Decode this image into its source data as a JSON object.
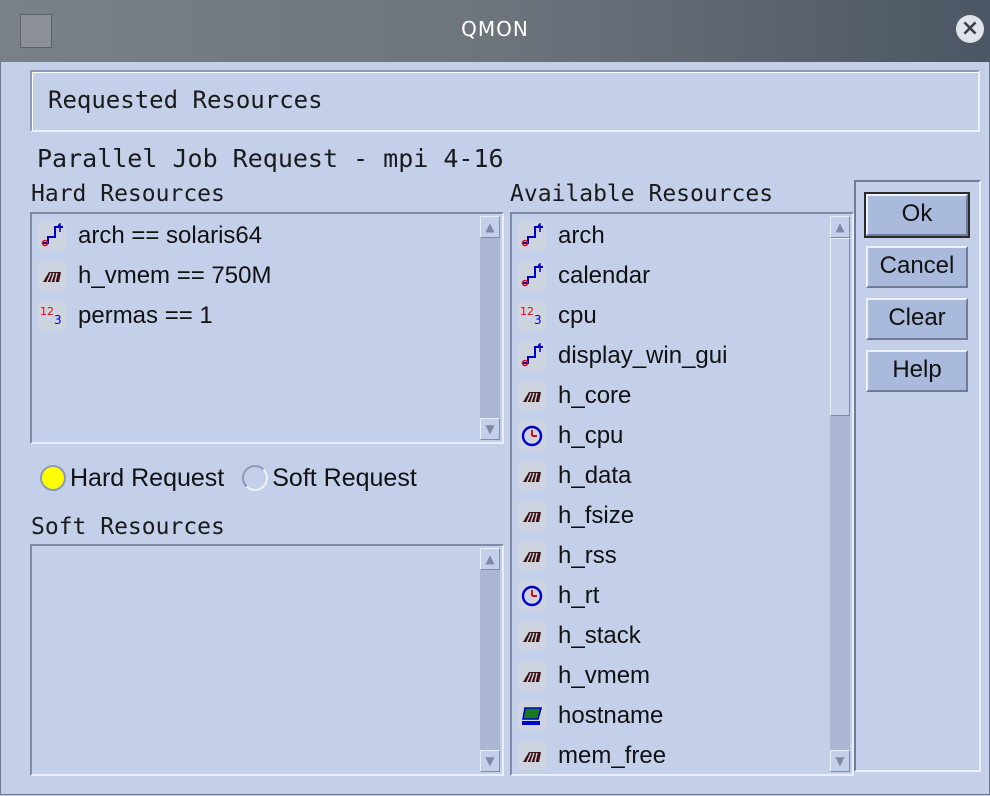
{
  "window": {
    "title": "QMON"
  },
  "header": {
    "requested_resources": "Requested Resources"
  },
  "labels": {
    "parallel_job": "Parallel Job Request - mpi 4-16",
    "hard_resources": "Hard Resources",
    "available_resources": "Available Resources",
    "soft_resources": "Soft Resources"
  },
  "hard_resources": [
    {
      "icon": "string-icon",
      "text": "arch == solaris64"
    },
    {
      "icon": "memory-icon",
      "text": "h_vmem == 750M"
    },
    {
      "icon": "integer-icon",
      "text": "permas == 1"
    }
  ],
  "soft_resources": [],
  "request_type": {
    "hard_label": "Hard Request",
    "soft_label": "Soft Request",
    "selected": "hard"
  },
  "available_resources": [
    {
      "icon": "string-icon",
      "text": "arch"
    },
    {
      "icon": "string-icon",
      "text": "calendar"
    },
    {
      "icon": "integer-icon",
      "text": "cpu"
    },
    {
      "icon": "string-icon",
      "text": "display_win_gui"
    },
    {
      "icon": "memory-icon",
      "text": "h_core"
    },
    {
      "icon": "time-icon",
      "text": "h_cpu"
    },
    {
      "icon": "memory-icon",
      "text": "h_data"
    },
    {
      "icon": "memory-icon",
      "text": "h_fsize"
    },
    {
      "icon": "memory-icon",
      "text": "h_rss"
    },
    {
      "icon": "time-icon",
      "text": "h_rt"
    },
    {
      "icon": "memory-icon",
      "text": "h_stack"
    },
    {
      "icon": "memory-icon",
      "text": "h_vmem"
    },
    {
      "icon": "host-icon",
      "text": "hostname"
    },
    {
      "icon": "memory-icon",
      "text": "mem_free"
    }
  ],
  "buttons": {
    "ok": "Ok",
    "cancel": "Cancel",
    "clear": "Clear",
    "help": "Help"
  },
  "colors": {
    "background": "#c4d0ea",
    "radio_selected": "#ffff00",
    "button_face": "#aabadc"
  }
}
